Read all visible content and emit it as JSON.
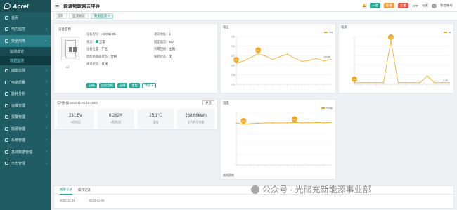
{
  "sidebar": {
    "logo": "Acrel",
    "items": [
      {
        "label": "首页"
      },
      {
        "label": "电力监控"
      },
      {
        "label": "安全用电"
      },
      {
        "label": "储能监测"
      },
      {
        "label": "电能质量"
      },
      {
        "label": "能耗分析"
      },
      {
        "label": "运维管理"
      },
      {
        "label": "报警管理"
      },
      {
        "label": "能源管理"
      },
      {
        "label": "系统管理"
      },
      {
        "label": "基础数据管理"
      },
      {
        "label": "日志管理"
      }
    ],
    "subitems": [
      {
        "label": "监测总览"
      },
      {
        "label": "数据监测"
      }
    ]
  },
  "topbar": {
    "title": "能源物联网云平台",
    "badge1": "一键",
    "badge2": "报警",
    "badge3": "告警",
    "link1": "APP",
    "link2": "设置",
    "user": "管理账号"
  },
  "tabs": [
    {
      "label": "首页"
    },
    {
      "label": "监测总览"
    },
    {
      "label": "数据监测 ×"
    }
  ],
  "device": {
    "name": "设备名称",
    "sub": "AT",
    "info": [
      {
        "k": "设备型号：",
        "v": "ASCB1-25"
      },
      {
        "k": "通讯地址：",
        "v": "1"
      },
      {
        "k": "状态：",
        "v": "正常"
      },
      {
        "k": "额定电流：",
        "v": "63A"
      },
      {
        "k": "设备位置：",
        "v": "厂区"
      },
      {
        "k": "所属回路：",
        "v": "主路"
      },
      {
        "k": "智能断路器状态：",
        "v": "合闸"
      },
      {
        "k": "报警状态：",
        "v": "无"
      },
      {
        "k": "通讯状态：",
        "v": "在线"
      }
    ],
    "buttons": [
      "分闸",
      "远程合闸",
      "分闸",
      "复位",
      "更多 ▾"
    ]
  },
  "realtime": {
    "title": "实时数据  2022-11-05 15:43:00",
    "more": "更多",
    "cards": [
      {
        "value": "231.5V",
        "label": "A相电压"
      },
      {
        "value": "0.262A",
        "label": "A相电流"
      },
      {
        "value": "25.1℃",
        "label": "温度"
      },
      {
        "value": "268.66kWh",
        "label": "正向有功电能"
      }
    ]
  },
  "charts": {
    "voltage": {
      "title": "电压",
      "legend": "Ua"
    },
    "current": {
      "title": "电流",
      "legend": "Ia"
    },
    "temp": {
      "title": "温度",
      "legend": "Temp"
    },
    "footer": "曲线趋势"
  },
  "chart_data": [
    {
      "type": "line",
      "title": "电压",
      "series": [
        {
          "name": "Ua",
          "values": [
            230.4,
            230.9,
            231.6,
            232.4,
            231.9,
            231.2,
            231.8,
            232.3,
            231.5,
            230.8,
            231.0,
            231.4,
            230.9,
            231.2
          ]
        }
      ],
      "ylim": [
        226,
        236
      ],
      "yticks": [
        "236",
        "234",
        "232",
        "230",
        "228",
        "226"
      ],
      "annotations": [
        "230.1",
        "232.4",
        "230.8"
      ]
    },
    {
      "type": "line",
      "title": "电流",
      "series": [
        {
          "name": "Ia",
          "values": [
            0.26,
            0.26,
            0.26,
            0.26,
            0.26,
            7.3,
            0.26,
            0.26,
            0.26,
            0.26,
            1.4,
            0.26,
            0.26,
            0.26
          ]
        }
      ],
      "ylim": [
        0,
        8
      ],
      "annotations": [
        "7.34",
        "1.43",
        "0.26"
      ]
    },
    {
      "type": "line",
      "title": "温度",
      "series": [
        {
          "name": "Temp",
          "values": [
            24.0,
            23.2,
            23.6,
            23.9,
            24.0,
            24.1,
            24.0,
            24.1,
            24.2,
            24.1,
            24.1,
            24.2,
            24.1,
            24.2
          ]
        }
      ],
      "ylim": [
        0,
        30
      ],
      "annotations": [
        "24.2",
        "24.1"
      ]
    }
  ],
  "bottom": {
    "tabs": [
      "报警记录",
      "操作记录"
    ],
    "date_from": "2022-11-01",
    "date_to": "2022-11-05"
  },
  "watermark": "公众号 · 光储充新能源事业部"
}
